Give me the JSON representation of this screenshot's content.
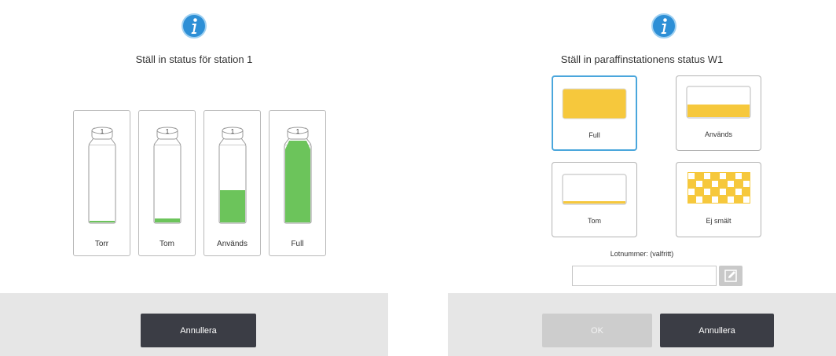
{
  "left_dialog": {
    "icon": "info-icon",
    "title": "Ställ in status för station 1",
    "bottles": [
      {
        "number": "1",
        "label": "Torr",
        "fill_fraction": 0.02
      },
      {
        "number": "1",
        "label": "Tom",
        "fill_fraction": 0.06
      },
      {
        "number": "1",
        "label": "Används",
        "fill_fraction": 0.42
      },
      {
        "number": "1",
        "label": "Full",
        "fill_fraction": 0.94
      }
    ],
    "cancel_label": "Annullera"
  },
  "right_dialog": {
    "icon": "info-icon",
    "title": "Ställ in paraffinstationens status W1",
    "options": [
      {
        "label": "Full",
        "state": "full",
        "selected": true
      },
      {
        "label": "Används",
        "state": "partial",
        "selected": false
      },
      {
        "label": "Tom",
        "state": "empty",
        "selected": false
      },
      {
        "label": "Ej smält",
        "state": "unmelted",
        "selected": false
      }
    ],
    "lot_label": "Lotnummer: (valfritt)",
    "lot_value": "",
    "ok_label": "OK",
    "cancel_label": "Annullera"
  },
  "colors": {
    "reagent_green": "#6cc45b",
    "paraffin_yellow": "#f6c83c",
    "info_blue": "#2d8fd6",
    "selected_border": "#4aa6dc",
    "button_dark": "#3b3d45",
    "button_disabled": "#cdcdcd",
    "footer": "#e6e6e6"
  }
}
